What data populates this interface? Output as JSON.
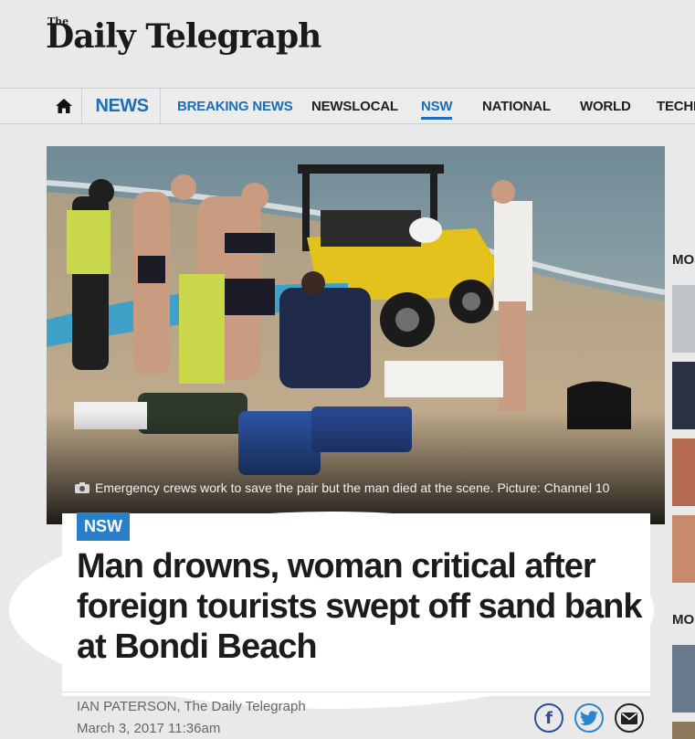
{
  "logo": {
    "the": "The",
    "name": "Daily Telegraph"
  },
  "nav": {
    "section": "NEWS",
    "items": [
      "BREAKING NEWS",
      "NEWSLOCAL",
      "NSW",
      "NATIONAL",
      "WORLD",
      "TECHN"
    ]
  },
  "hero": {
    "caption": "Emergency crews work to save the pair but the man died at the scene. Picture: Channel 10"
  },
  "article": {
    "tag": "NSW",
    "headline": "Man drowns, woman critical after foreign tourists swept off sand bank at Bondi Beach",
    "author": "IAN PATERSON, The Daily Telegraph",
    "date": "March 3, 2017 11:36am"
  },
  "rail": {
    "label1": "MOS",
    "label2": "MO"
  },
  "colors": {
    "brand_blue": "#1a6fb8",
    "tag_blue": "#2a7fc9"
  }
}
